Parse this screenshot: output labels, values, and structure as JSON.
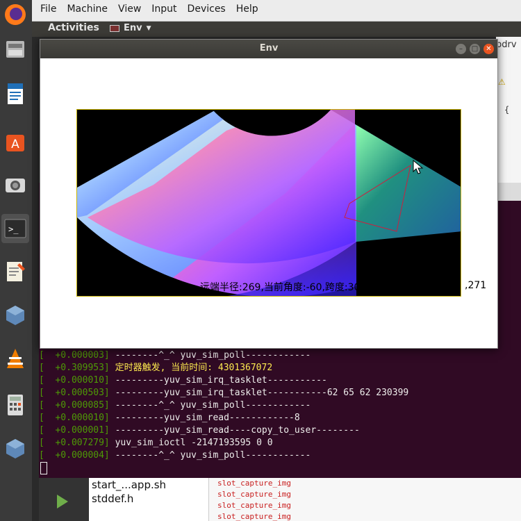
{
  "host_menu": [
    "File",
    "Machine",
    "View",
    "Input",
    "Devices",
    "Help"
  ],
  "guest_panel": {
    "activities": "Activities",
    "app_name": "Env"
  },
  "env_window": {
    "title": "Env",
    "status_text": "远端半径:269,当前角度:-60,跨度:30,视图",
    "status_tail": ",271"
  },
  "editor_bg": {
    "tab": "bdrv",
    "brace": "{"
  },
  "terminal": {
    "lines": [
      {
        "ts": "[  +0.000003]",
        "msg": " --------^_^ yuv_sim_poll------------",
        "warn": false
      },
      {
        "ts": "[  +0.309953]",
        "msg": " 定时器触发, 当前时间: 4301367072",
        "warn": true
      },
      {
        "ts": "[  +0.000010]",
        "msg": " ---------yuv_sim_irq_tasklet-----------",
        "warn": false
      },
      {
        "ts": "[  +0.000503]",
        "msg": " ---------yuv_sim_irq_tasklet-----------62 65 62 230399",
        "warn": false
      },
      {
        "ts": "[  +0.000085]",
        "msg": " --------^_^ yuv_sim_poll------------",
        "warn": false
      },
      {
        "ts": "[  +0.000010]",
        "msg": " ---------yuv_sim_read------------8",
        "warn": false
      },
      {
        "ts": "[  +0.000001]",
        "msg": " ---------yuv_sim_read----copy_to_user--------",
        "warn": false
      },
      {
        "ts": "[  +0.007279]",
        "msg": " yuv_sim_ioctl -2147193595 0 0",
        "warn": false
      },
      {
        "ts": "[  +0.000004]",
        "msg": " --------^_^ yuv_sim_poll------------",
        "warn": false
      }
    ]
  },
  "file_pane": {
    "files": [
      "start_...app.sh",
      "stddef.h"
    ]
  },
  "output_pane": {
    "lines": [
      "slot_capture_img",
      "slot_capture_img",
      "slot_capture_img",
      "slot_capture_img"
    ]
  }
}
